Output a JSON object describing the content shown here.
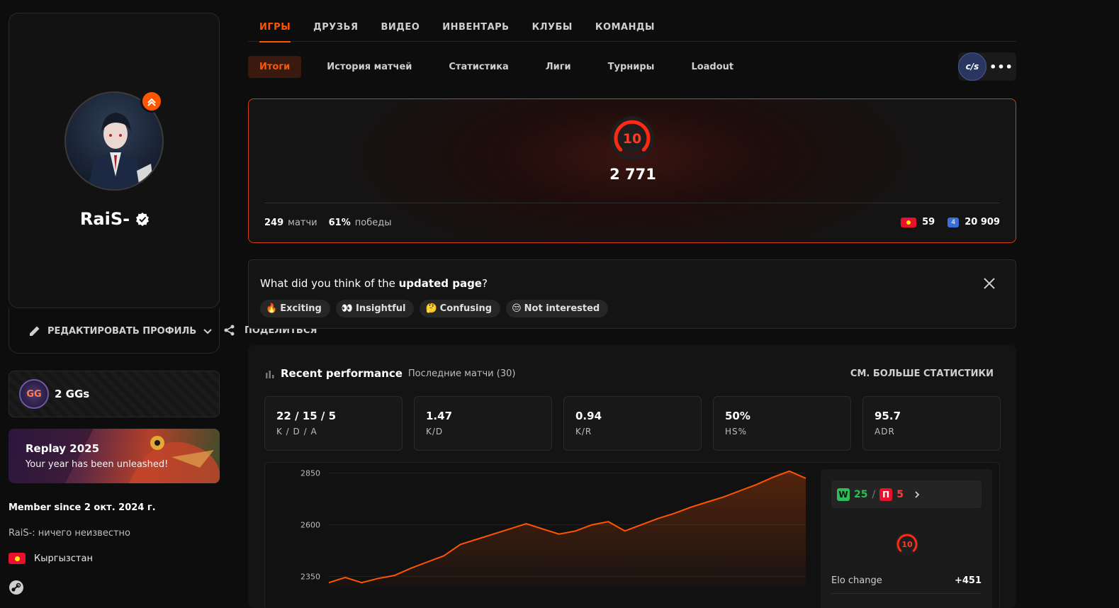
{
  "profile": {
    "nickname": "RaiS-",
    "edit_label": "РЕДАКТИРОВАТЬ ПРОФИЛЬ",
    "share_label": "ПОДЕЛИТЬСЯ",
    "member_since": "Member since 2 окт. 2024 г.",
    "bio": "RaiS-: ничего неизвестно",
    "country": "Кыргызстан"
  },
  "gg": {
    "label": "2 GGs",
    "logo_text": "GG"
  },
  "replay": {
    "title": "Replay 2025",
    "subtitle": "Your year has been unleashed!"
  },
  "top_nav": [
    "ИГРЫ",
    "ДРУЗЬЯ",
    "ВИДЕО",
    "ИНВЕНТАРЬ",
    "КЛУБЫ",
    "КОМАНДЫ"
  ],
  "sub_nav": [
    "Итоги",
    "История матчей",
    "Статистика",
    "Лиги",
    "Турниры",
    "Loadout"
  ],
  "game_switch": {
    "game_label": "c/s",
    "more": "•••"
  },
  "elo": {
    "level": "10",
    "value": "2 771",
    "matches": "249",
    "matches_label": "матчи",
    "winrate": "61%",
    "winrate_label": "победы",
    "country_rank": "59",
    "region_rank": "20 909"
  },
  "feedback": {
    "question_prefix": "What did you think of the ",
    "question_bold": "updated page",
    "question_suffix": "?",
    "options": [
      {
        "emoji": "🔥",
        "label": "Exciting"
      },
      {
        "emoji": "👀",
        "label": "Insightful"
      },
      {
        "emoji": "🤔",
        "label": "Confusing"
      },
      {
        "emoji": "😒",
        "label": "Not interested"
      }
    ]
  },
  "performance": {
    "title": "Recent performance",
    "subtitle": "Последние матчи (30)",
    "more_label": "СМ. БОЛЬШЕ СТАТИСТИКИ",
    "stats": [
      {
        "value": "22 / 15 / 5",
        "label": "K / D / A"
      },
      {
        "value": "1.47",
        "label": "K/D"
      },
      {
        "value": "0.94",
        "label": "K/R"
      },
      {
        "value": "50%",
        "label": "HS%"
      },
      {
        "value": "95.7",
        "label": "ADR"
      }
    ],
    "wins": "25",
    "losses": "5",
    "w_badge": "W",
    "l_badge": "П",
    "wl_separator": "/",
    "level": "10",
    "elo_change_label": "Elo change",
    "elo_change_value": "+451"
  },
  "colors": {
    "accent": "#ff5500",
    "win": "#2ebd59",
    "loss": "#e8112d"
  },
  "chart_data": {
    "type": "area",
    "title": "",
    "xlabel": "",
    "ylabel": "",
    "ylim": [
      2300,
      2880
    ],
    "yticks": [
      2350,
      2600,
      2850
    ],
    "series": [
      {
        "values": [
          2320,
          2345,
          2320,
          2340,
          2355,
          2390,
          2420,
          2450,
          2505,
          2530,
          2555,
          2580,
          2605,
          2580,
          2555,
          2570,
          2600,
          2615,
          2570,
          2600,
          2630,
          2655,
          2685,
          2710,
          2735,
          2765,
          2795,
          2830,
          2860,
          2825
        ]
      }
    ]
  }
}
